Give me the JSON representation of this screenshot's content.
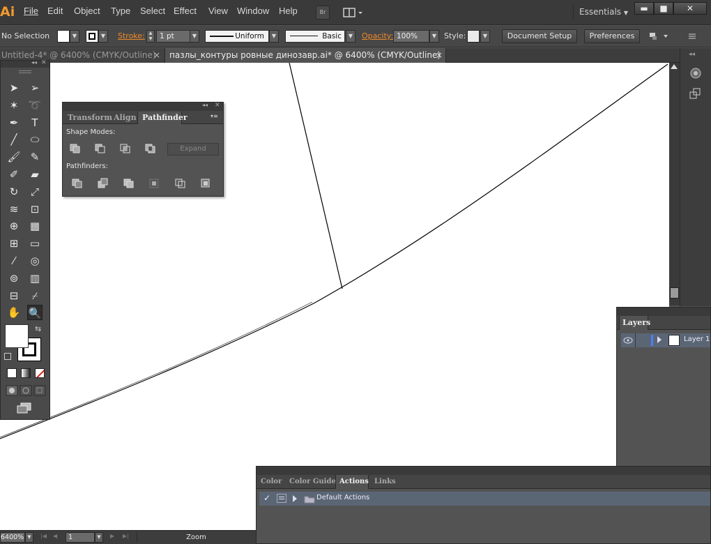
{
  "app": {
    "logo": "Ai",
    "workspace": "Essentials",
    "bridge_label": "Br"
  },
  "menus": [
    "File",
    "Edit",
    "Object",
    "Type",
    "Select",
    "Effect",
    "View",
    "Window",
    "Help"
  ],
  "window_controls": {
    "minimize": "▬",
    "maximize": "■",
    "close": "✕"
  },
  "control_bar": {
    "selection": "No Selection",
    "stroke_label": "Stroke:",
    "stroke_weight": "1 pt",
    "profile": "Uniform",
    "brush": "Basic",
    "opacity_label": "Opacity:",
    "opacity": "100%",
    "style_label": "Style:",
    "document_setup": "Document Setup",
    "preferences": "Preferences"
  },
  "tabs": [
    {
      "title": "Untitled-4* @ 6400% (CMYK/Outline)",
      "close": "×"
    },
    {
      "title": "пазлы_контуры ровные динозавр.ai* @ 6400% (CMYK/Outline)",
      "close": "×"
    }
  ],
  "pathfinder": {
    "tabs": [
      "Transform",
      "Align",
      "Pathfinder"
    ],
    "active_tab": "Pathfinder",
    "shape_modes_label": "Shape Modes:",
    "expand": "Expand",
    "pathfinders_label": "Pathfinders:"
  },
  "toolbox": {
    "tools": [
      "selection-icon",
      "direct-selection-icon",
      "magic-wand-icon",
      "lasso-icon",
      "pen-icon",
      "type-icon",
      "line-icon",
      "ellipse-icon",
      "paintbrush-icon",
      "pencil-icon",
      "blob-brush-icon",
      "eraser-icon",
      "rotate-icon",
      "scale-icon",
      "warp-icon",
      "free-transform-icon",
      "shape-builder-icon",
      "perspective-grid-icon",
      "mesh-icon",
      "gradient-icon",
      "eyedropper-icon",
      "blend-icon",
      "symbol-sprayer-icon",
      "column-graph-icon",
      "artboard-icon",
      "slice-icon",
      "hand-icon",
      "zoom-icon"
    ],
    "type_glyph": "T"
  },
  "layers": {
    "title": "Layers",
    "items": [
      {
        "name": "Layer 1"
      }
    ]
  },
  "bottom_panel": {
    "tabs": [
      "Color",
      "Color Guide",
      "Actions",
      "Links"
    ],
    "active_tab": "Actions",
    "items": [
      {
        "name": "Default Actions"
      }
    ]
  },
  "status": {
    "zoom": "6400%",
    "artboard": "1",
    "tool": "Zoom"
  },
  "colors": {
    "accent": "#ef8a2a",
    "bg": "#535353",
    "selected_row": "#5b6675"
  }
}
